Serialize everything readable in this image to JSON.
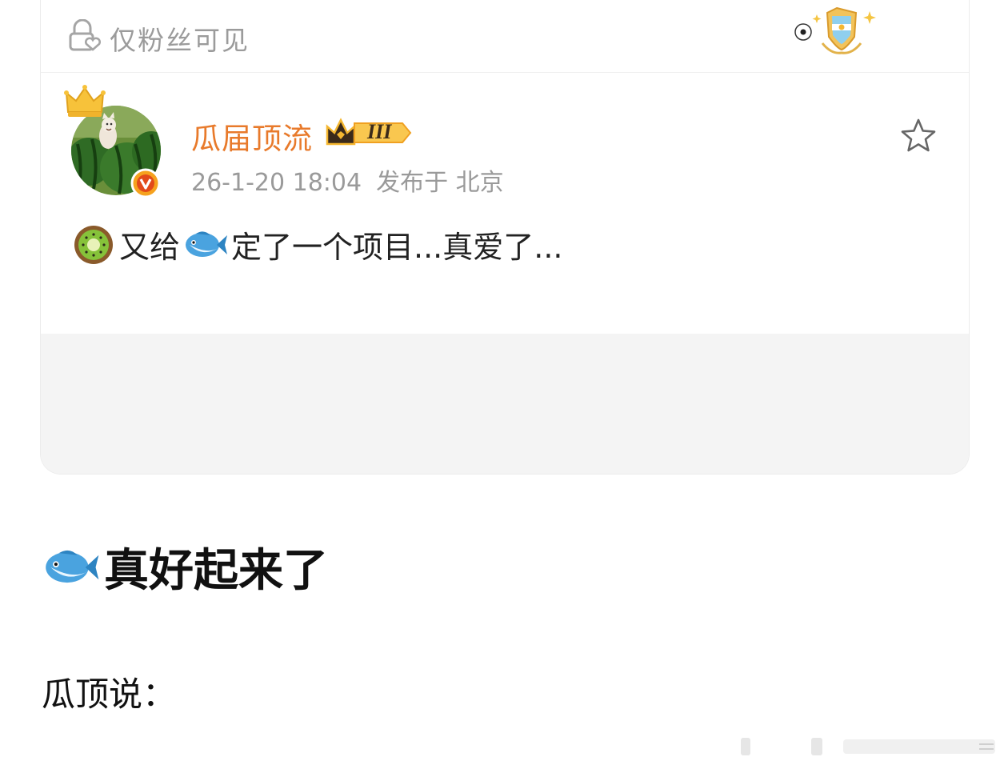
{
  "visibility": {
    "label": "仅粉丝可见",
    "icon": "lock-heart-icon"
  },
  "profile": {
    "username": "瓜届顶流",
    "level_badge": "III",
    "date": "26-1-20 18:04",
    "posted_at": "发布于 北京",
    "avatar": "watermelon-cat-avatar"
  },
  "post": {
    "text_1": "又给",
    "text_2": "定了一个项目...真爱了..."
  },
  "article": {
    "headline": "真好起来了",
    "subhead": "瓜顶说："
  },
  "colors": {
    "username": "#e87a2b",
    "muted": "#9a9a9a",
    "accent": "#f5a623"
  }
}
